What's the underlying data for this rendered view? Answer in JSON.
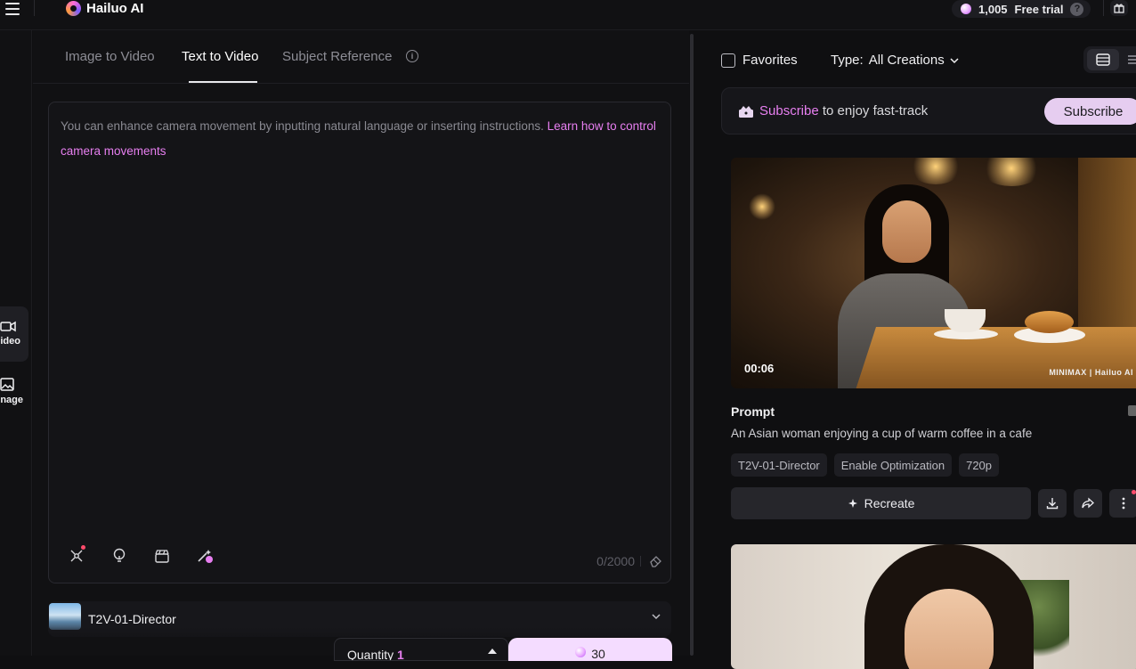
{
  "topbar": {
    "brand": "Hailuo AI",
    "credits": "1,005",
    "free_trial": "Free trial",
    "help_glyph": "?"
  },
  "left_rail": {
    "items": [
      {
        "label": "Video",
        "icon": "video-icon",
        "active": true
      },
      {
        "label": "Image",
        "icon": "image-icon",
        "active": false
      }
    ]
  },
  "tabs": [
    {
      "label": "Image to Video"
    },
    {
      "label": "Text to Video"
    },
    {
      "label": "Subject Reference"
    }
  ],
  "editor": {
    "placeholder": "You can enhance camera movement by inputting natural language or inserting instructions.",
    "link": "Learn how to control camera movements",
    "counter": "0/2000"
  },
  "model": {
    "name": "T2V-01-Director"
  },
  "generate": {
    "quantity_label": "Quantity",
    "quantity_value": "1",
    "cost": "30"
  },
  "filters": {
    "favorites": "Favorites",
    "type_label": "Type:",
    "type_value": "All Creations"
  },
  "subscribe": {
    "text_accent": "Subscribe",
    "text_rest": "to enjoy fast-track",
    "button": "Subscribe"
  },
  "creation": {
    "duration": "00:06",
    "watermark": "MINIMAX | Hailuo AI",
    "prompt_label": "Prompt",
    "prompt_text": "An Asian woman enjoying a cup of warm coffee in a cafe",
    "tags": [
      "T2V-01-Director",
      "Enable Optimization",
      "720p"
    ],
    "recreate": "Recreate"
  },
  "colors": {
    "accent": "#e77ff0",
    "background": "#0f0f11",
    "panel": "#111113"
  }
}
